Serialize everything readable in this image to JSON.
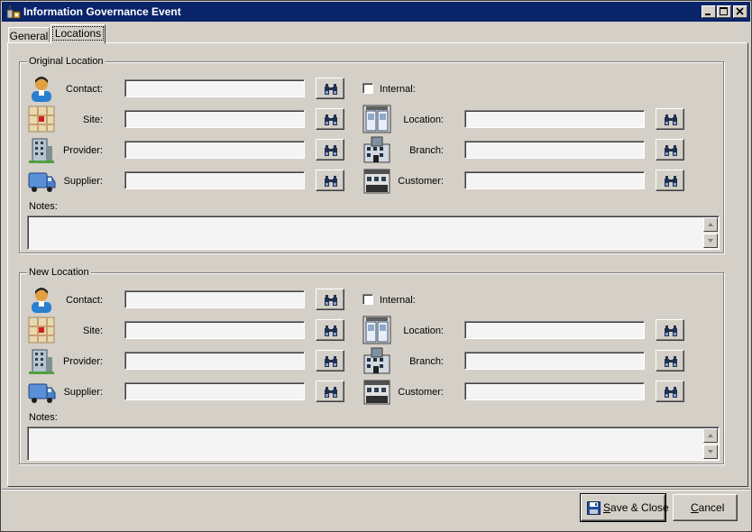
{
  "window": {
    "title": "Information Governance Event"
  },
  "tabs": [
    {
      "label": "General"
    },
    {
      "label": "Locations"
    }
  ],
  "original": {
    "legend": "Original Location",
    "contact_label": "Contact:",
    "internal_label": "Internal:",
    "site_label": "Site:",
    "location_label": "Location:",
    "provider_label": "Provider:",
    "branch_label": "Branch:",
    "supplier_label": "Supplier:",
    "customer_label": "Customer:",
    "notes_label": "Notes:",
    "contact_value": "",
    "site_value": "",
    "provider_value": "",
    "supplier_value": "",
    "location_value": "",
    "branch_value": "",
    "customer_value": "",
    "notes_value": ""
  },
  "new": {
    "legend": "New Location",
    "contact_label": "Contact:",
    "internal_label": "Internal:",
    "site_label": "Site:",
    "location_label": "Location:",
    "provider_label": "Provider:",
    "branch_label": "Branch:",
    "supplier_label": "Supplier:",
    "customer_label": "Customer:",
    "notes_label": "Notes:",
    "contact_value": "",
    "site_value": "",
    "provider_value": "",
    "supplier_value": "",
    "location_value": "",
    "branch_value": "",
    "customer_value": "",
    "notes_value": ""
  },
  "footer": {
    "save_prefix": "S",
    "save_rest": "ave & Close",
    "cancel_prefix": "C",
    "cancel_rest": "ancel"
  },
  "icons": {
    "contact": "person-icon",
    "site": "map-icon",
    "provider": "building-icon",
    "supplier": "truck-icon",
    "location": "doors-icon",
    "branch": "office-icon",
    "customer": "storefront-icon",
    "find": "binoculars-icon",
    "save": "floppy-disk-icon"
  }
}
